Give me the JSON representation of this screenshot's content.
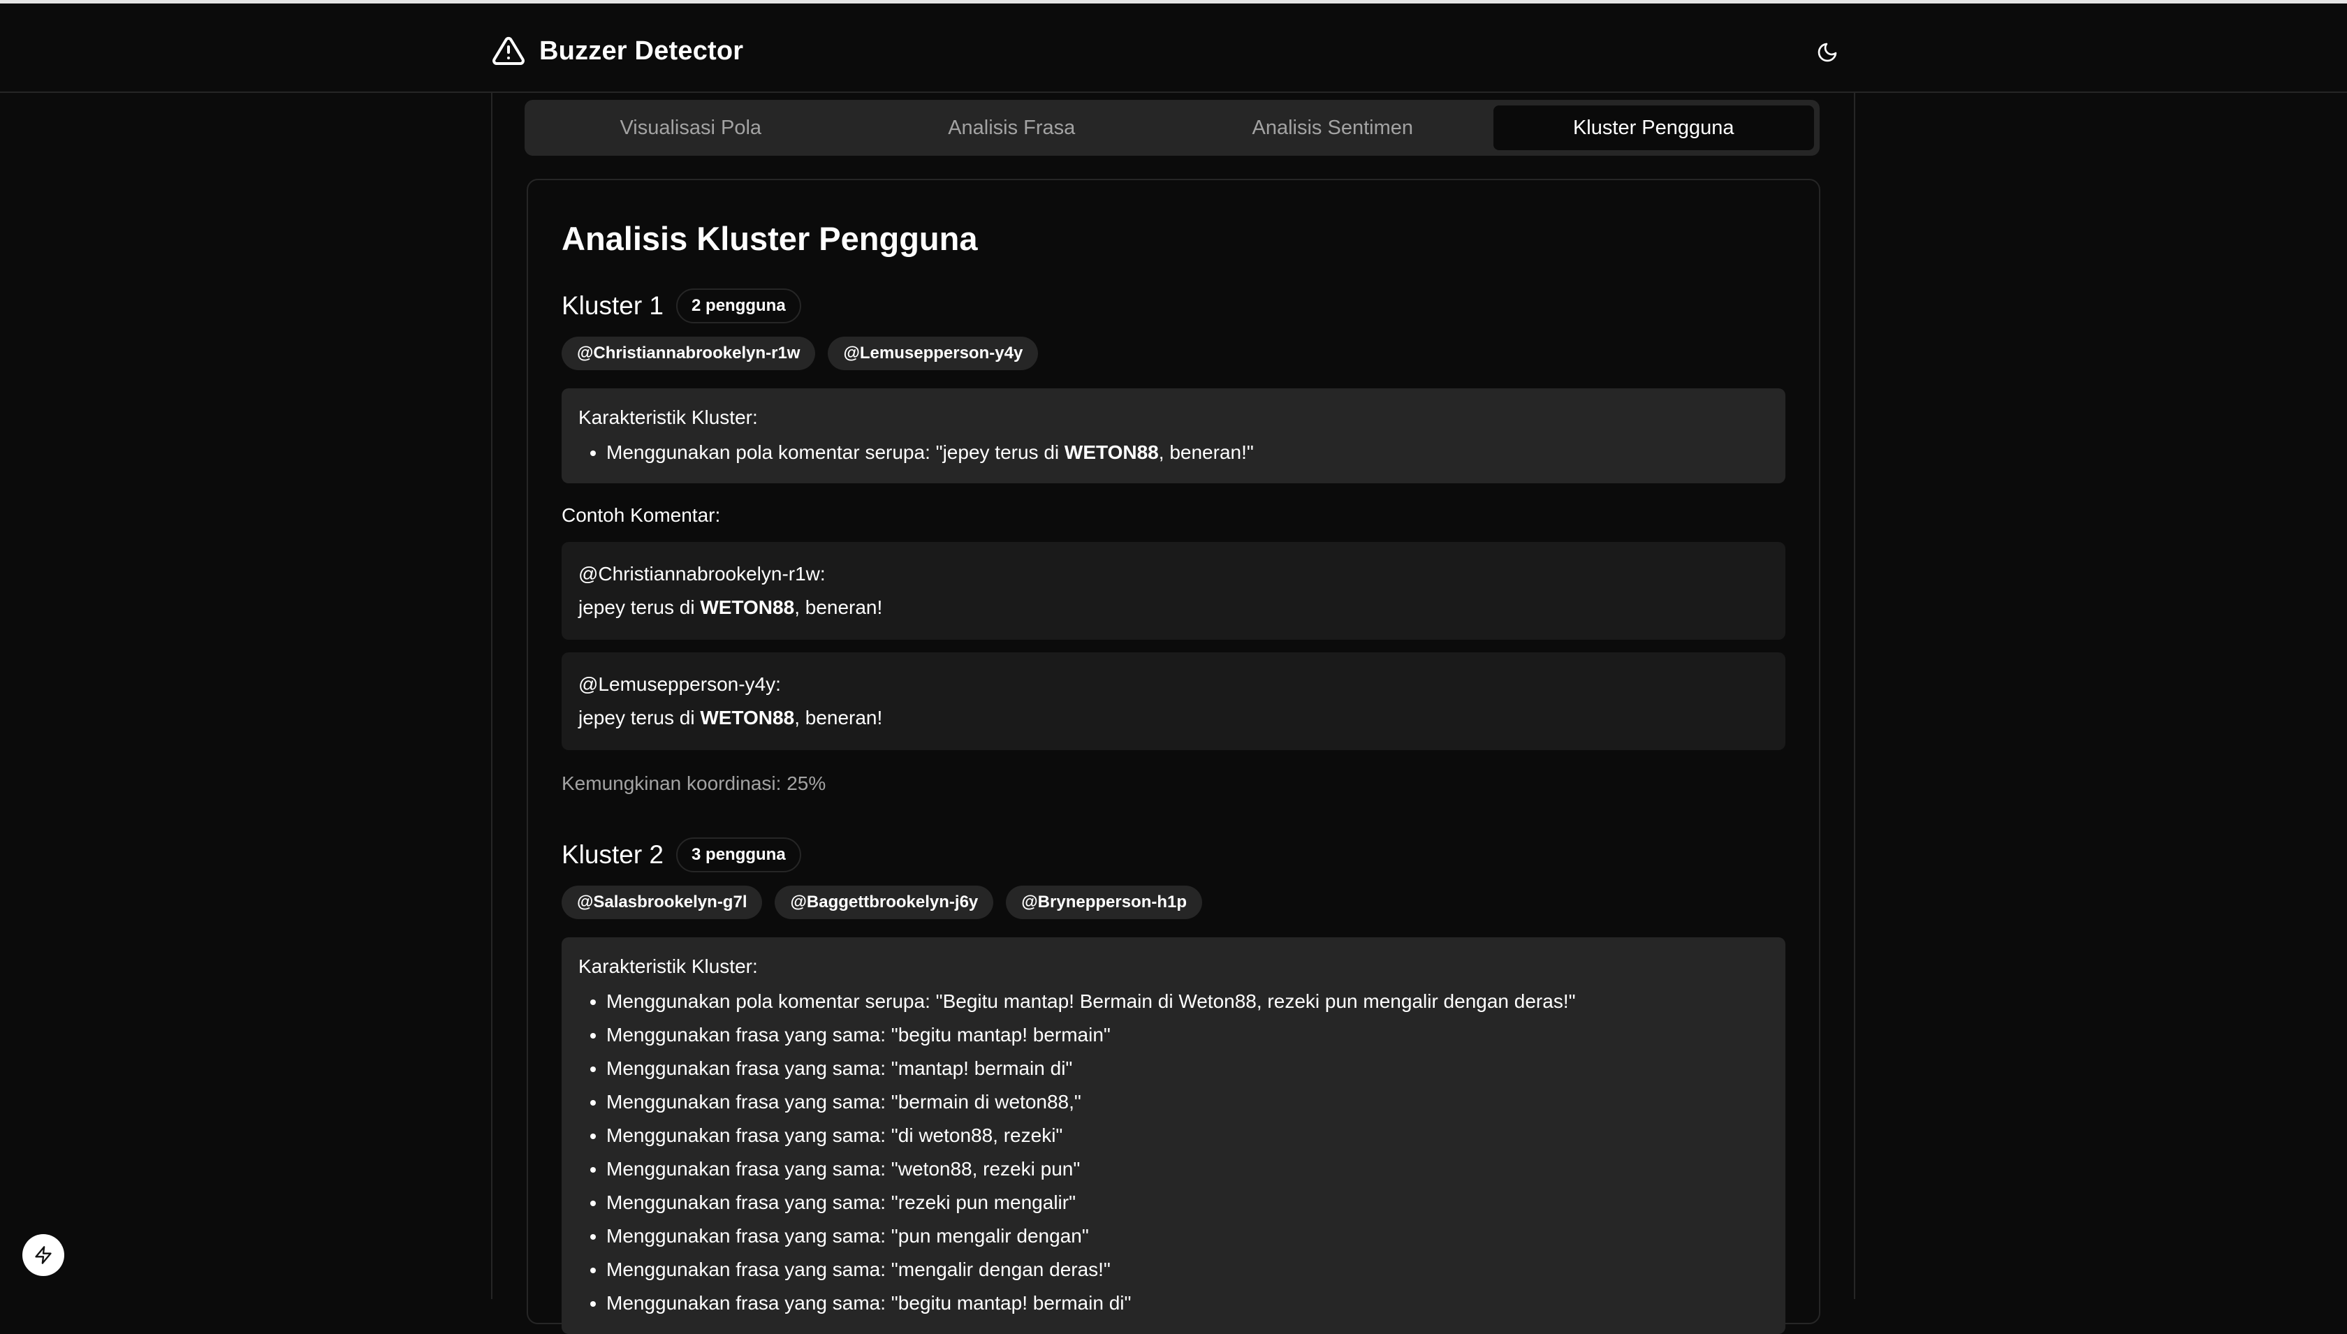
{
  "app": {
    "title": "Buzzer Detector"
  },
  "tabs": [
    {
      "label": "Visualisasi Pola",
      "active": false
    },
    {
      "label": "Analisis Frasa",
      "active": false
    },
    {
      "label": "Analisis Sentimen",
      "active": false
    },
    {
      "label": "Kluster Pengguna",
      "active": true
    }
  ],
  "page": {
    "title": "Analisis Kluster Pengguna"
  },
  "labels": {
    "characteristics": "Karakteristik Kluster:",
    "examples": "Contoh Komentar:"
  },
  "clusters": [
    {
      "title": "Kluster 1",
      "count": "2 pengguna",
      "users": [
        "@Christiannabrookelyn-r1w",
        "@Lemusepperson-y4y"
      ],
      "characteristics": [
        {
          "prefix": "Menggunakan pola komentar serupa: \"jepey terus di ",
          "bold": "WETON88",
          "suffix": ", beneran!\""
        }
      ],
      "comments": [
        {
          "user": "@Christiannabrookelyn-r1w:",
          "prefix": "jepey terus di ",
          "bold": "WETON88",
          "suffix": ", beneran!"
        },
        {
          "user": "@Lemusepperson-y4y:",
          "prefix": "jepey terus di ",
          "bold": "WETON88",
          "suffix": ", beneran!"
        }
      ],
      "probability": "Kemungkinan koordinasi: 25%"
    },
    {
      "title": "Kluster 2",
      "count": "3 pengguna",
      "users": [
        "@Salasbrookelyn-g7l",
        "@Baggettbrookelyn-j6y",
        "@Brynepperson-h1p"
      ],
      "characteristics": [
        "Menggunakan pola komentar serupa: \"Begitu mantap! Bermain di Weton88, rezeki pun mengalir dengan deras!\"",
        "Menggunakan frasa yang sama: \"begitu mantap! bermain\"",
        "Menggunakan frasa yang sama: \"mantap! bermain di\"",
        "Menggunakan frasa yang sama: \"bermain di weton88,\"",
        "Menggunakan frasa yang sama: \"di weton88, rezeki\"",
        "Menggunakan frasa yang sama: \"weton88, rezeki pun\"",
        "Menggunakan frasa yang sama: \"rezeki pun mengalir\"",
        "Menggunakan frasa yang sama: \"pun mengalir dengan\"",
        "Menggunakan frasa yang sama: \"mengalir dengan deras!\"",
        "Menggunakan frasa yang sama: \"begitu mantap! bermain di\""
      ]
    }
  ]
}
